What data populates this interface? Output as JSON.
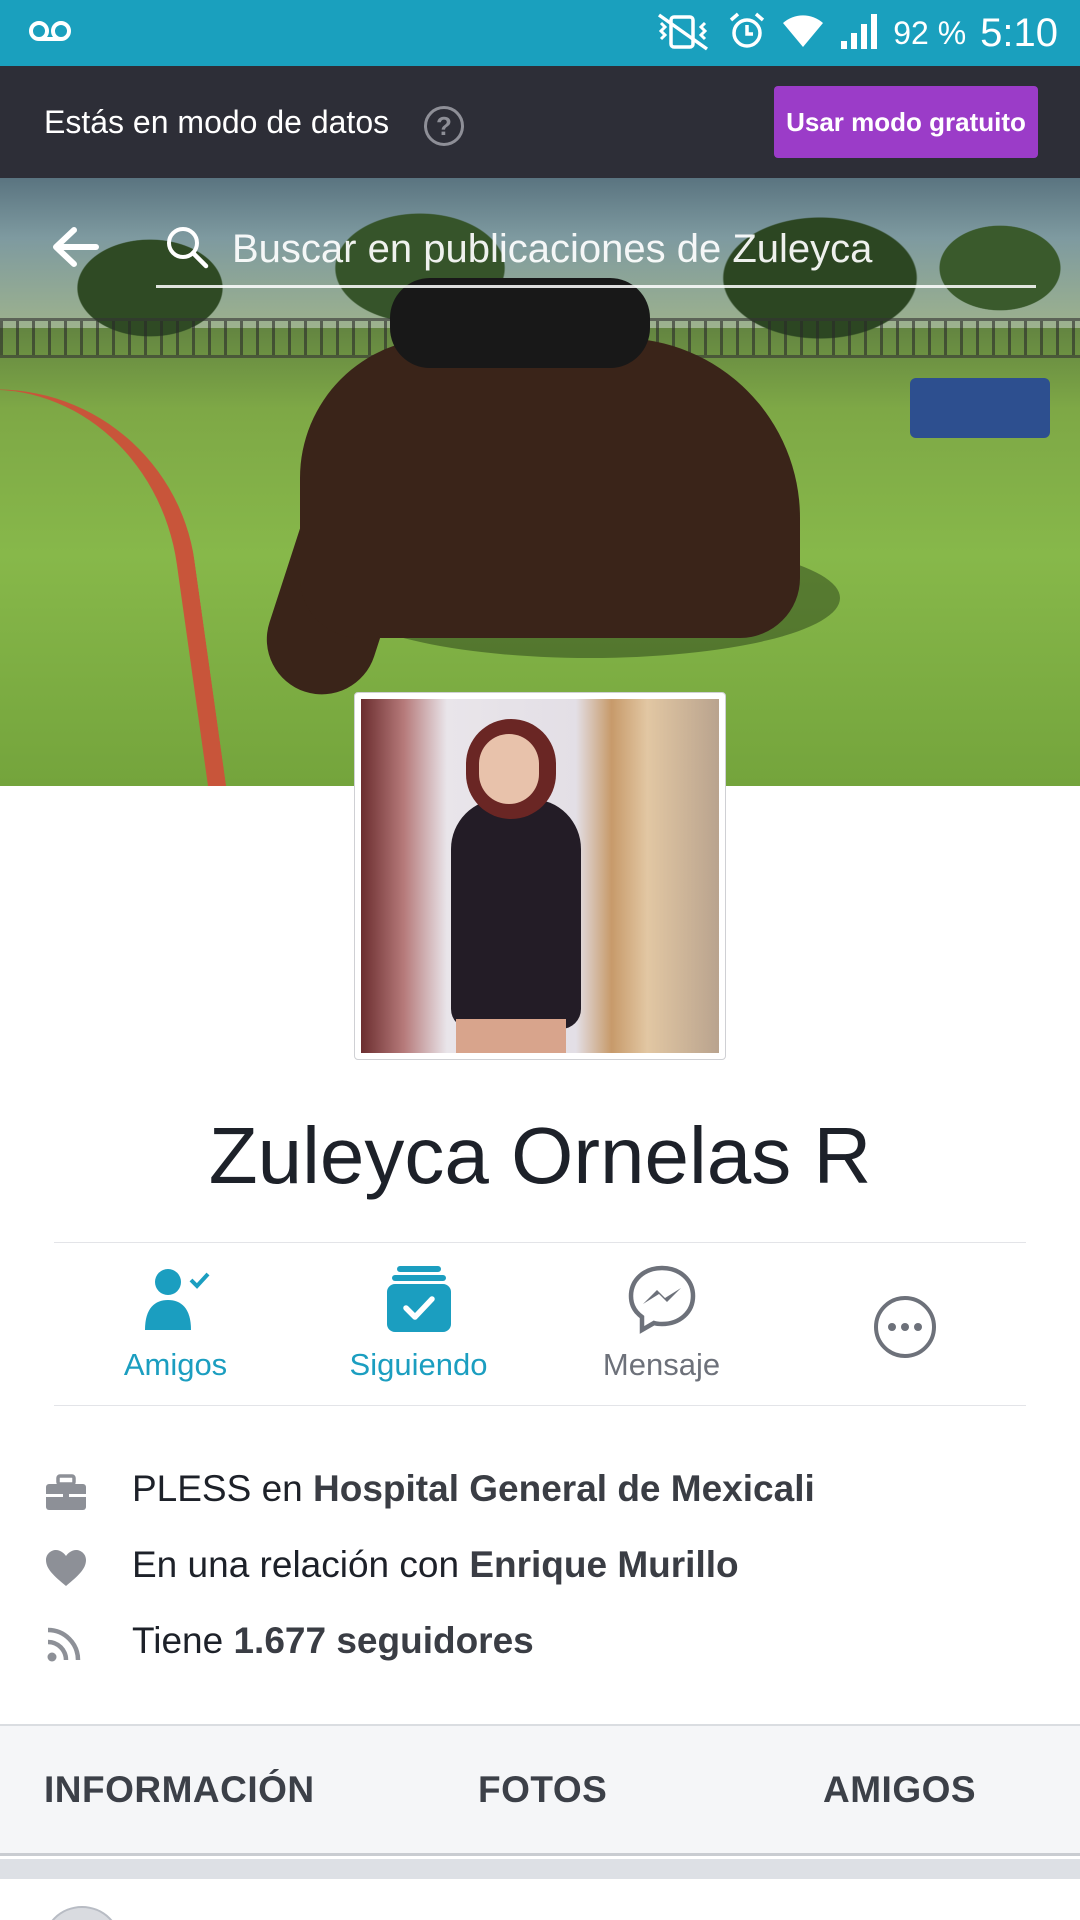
{
  "status_bar": {
    "voicemail_icon": "voicemail-icon",
    "battery_percent": "92 %",
    "time": "5:10"
  },
  "data_mode_bar": {
    "message": "Estás en modo de datos",
    "help_symbol": "?",
    "free_mode_button": "Usar modo gratuito"
  },
  "search": {
    "placeholder": "Buscar en publicaciones de Zuleyca"
  },
  "profile": {
    "name": "Zuleyca Ornelas R"
  },
  "actions": [
    {
      "label": "Amigos",
      "icon": "friends-check-icon"
    },
    {
      "label": "Siguiendo",
      "icon": "following-inbox-check-icon"
    },
    {
      "label": "Mensaje",
      "icon": "messenger-icon"
    },
    {
      "label": "",
      "icon": "more-options-icon"
    }
  ],
  "info": {
    "work": {
      "prefix": "PLESS en ",
      "place": "Hospital General de Mexicali"
    },
    "relationship": {
      "prefix": "En una relación con ",
      "partner": "Enrique Murillo"
    },
    "followers": {
      "prefix": "Tiene ",
      "count": "1.677 seguidores"
    }
  },
  "tabs": [
    "INFORMACIÓN",
    "FOTOS",
    "AMIGOS"
  ],
  "colors": {
    "status_bar": "#1aa0be",
    "data_bar": "#2d2e37",
    "free_button": "#9b3cc8",
    "accent_blue": "#1b9ec0",
    "gray_icon": "#6d717a"
  }
}
